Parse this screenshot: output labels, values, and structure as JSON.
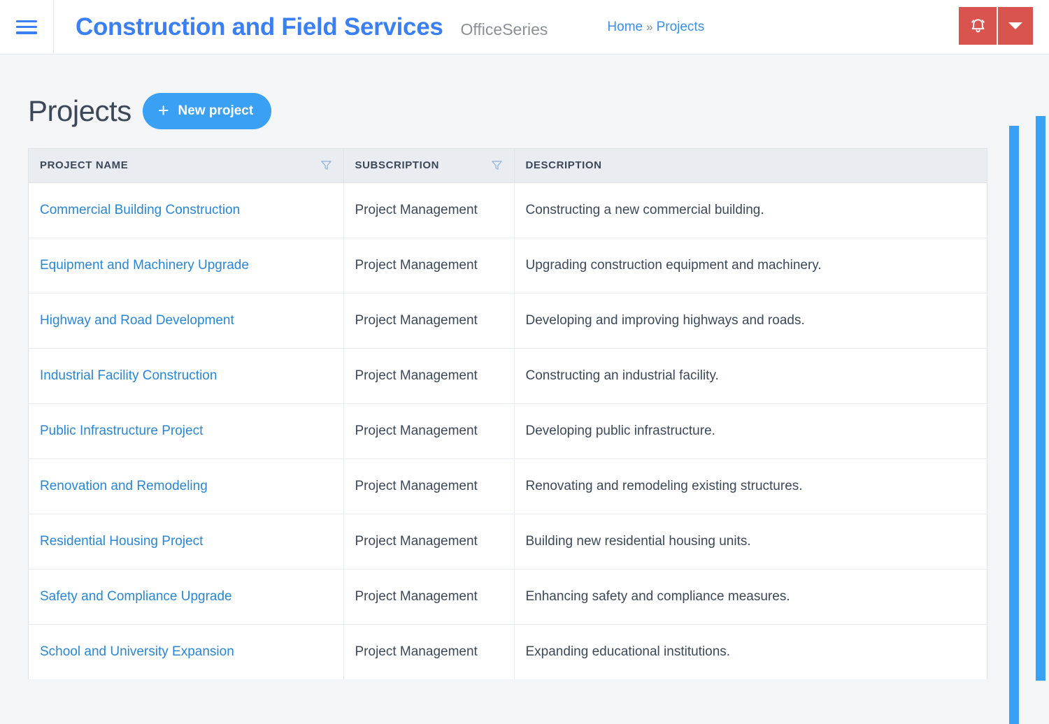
{
  "header": {
    "menu_icon": "hamburger-menu-icon",
    "app_title": "Construction and Field Services",
    "app_suite": "OfficeSeries",
    "breadcrumb": {
      "home_label": "Home",
      "separator": "»",
      "current_label": "Projects"
    },
    "actions": {
      "alarm_icon": "alarm-bell-icon",
      "caret_icon": "chevron-down-icon"
    },
    "colors": {
      "brand_blue": "#3b7ff5",
      "action_red": "#d9534f"
    }
  },
  "page": {
    "title": "Projects",
    "new_button": {
      "icon": "plus-icon",
      "label": "New project",
      "color": "#3aa0f3"
    }
  },
  "table": {
    "columns": [
      {
        "label": "PROJECT NAME",
        "filter_icon": "filter-funnel-icon",
        "filterable": true
      },
      {
        "label": "SUBSCRIPTION",
        "filter_icon": "filter-funnel-icon",
        "filterable": true
      },
      {
        "label": "DESCRIPTION",
        "filter_icon": null,
        "filterable": false
      }
    ],
    "rows": [
      {
        "name": "Commercial Building Construction",
        "subscription": "Project Management",
        "description": "Constructing a new commercial building."
      },
      {
        "name": "Equipment and Machinery Upgrade",
        "subscription": "Project Management",
        "description": "Upgrading construction equipment and machinery."
      },
      {
        "name": "Highway and Road Development",
        "subscription": "Project Management",
        "description": "Developing and improving highways and roads."
      },
      {
        "name": "Industrial Facility Construction",
        "subscription": "Project Management",
        "description": "Constructing an industrial facility."
      },
      {
        "name": "Public Infrastructure Project",
        "subscription": "Project Management",
        "description": "Developing public infrastructure."
      },
      {
        "name": "Renovation and Remodeling",
        "subscription": "Project Management",
        "description": "Renovating and remodeling existing structures."
      },
      {
        "name": "Residential Housing Project",
        "subscription": "Project Management",
        "description": "Building new residential housing units."
      },
      {
        "name": "Safety and Compliance Upgrade",
        "subscription": "Project Management",
        "description": "Enhancing safety and compliance measures."
      },
      {
        "name": "School and University Expansion",
        "subscription": "Project Management",
        "description": "Expanding educational institutions."
      }
    ]
  },
  "scrollbars": {
    "inner": {
      "name": "inner-content-scrollbar",
      "color": "#3aa0f3"
    },
    "outer": {
      "name": "page-scrollbar",
      "color": "#3aa0f3"
    }
  }
}
